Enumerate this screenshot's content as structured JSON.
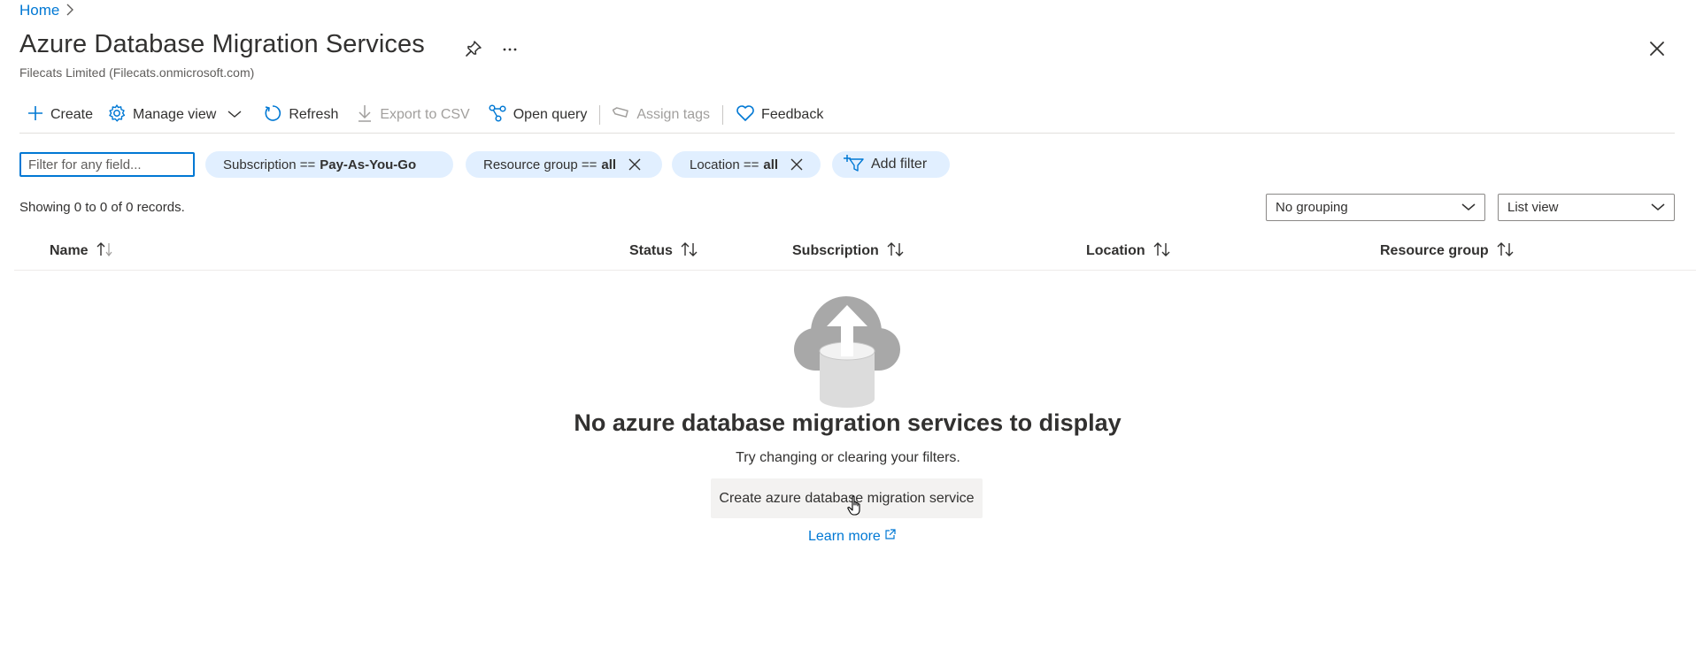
{
  "breadcrumb": {
    "home": "Home"
  },
  "header": {
    "title": "Azure Database Migration Services",
    "subtitle": "Filecats Limited (Filecats.onmicrosoft.com)",
    "more_label": "···"
  },
  "toolbar": {
    "create": "Create",
    "manage_view": "Manage view",
    "refresh": "Refresh",
    "export_csv": "Export to CSV",
    "open_query": "Open query",
    "assign_tags": "Assign tags",
    "feedback": "Feedback"
  },
  "filters": {
    "search_placeholder": "Filter for any field...",
    "pills": [
      {
        "label": "Subscription ==",
        "value": "Pay-As-You-Go"
      },
      {
        "label": "Resource group ==",
        "value": "all"
      },
      {
        "label": "Location ==",
        "value": "all"
      }
    ],
    "add_filter": "Add filter"
  },
  "records": {
    "summary": "Showing 0 to 0 of 0 records."
  },
  "view_options": {
    "grouping": "No grouping",
    "view": "List view"
  },
  "table": {
    "columns": [
      "Name",
      "Status",
      "Subscription",
      "Location",
      "Resource group"
    ]
  },
  "empty_state": {
    "title": "No azure database migration services to display",
    "subtitle": "Try changing or clearing your filters.",
    "create_button": "Create azure database migration service",
    "learn_more": "Learn more"
  },
  "colors": {
    "accent": "#0078d4",
    "pill_background": "#e1efff",
    "disabled_text": "#a19f9d"
  }
}
